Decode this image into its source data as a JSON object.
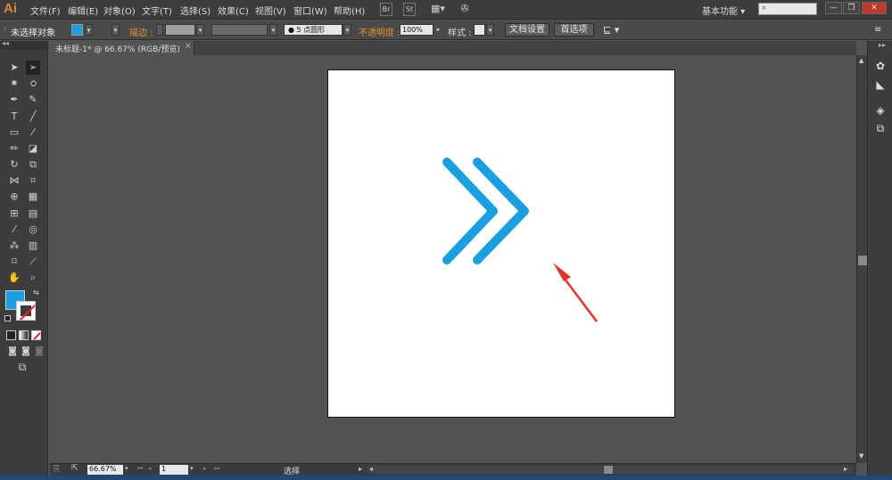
{
  "app": {
    "logo": "Ai",
    "menus": [
      "文件(F)",
      "编辑(E)",
      "对象(O)",
      "文字(T)",
      "选择(S)",
      "效果(C)",
      "视图(V)",
      "窗口(W)",
      "帮助(H)"
    ],
    "br_label": "Br",
    "st_label": "St",
    "workspace": "基本功能",
    "workspace_arrow": "▾",
    "search_placeholder": "",
    "minimize": "—",
    "restore": "❐",
    "close": "✕"
  },
  "control_bar": {
    "selection_label": "未选择对象",
    "stroke_label": "描边 :",
    "brush_value": "● 5 点圆形",
    "opacity_label": "不透明度 :",
    "opacity_value": "100%",
    "style_label": "样式 :",
    "doc_setup_label": "文档设置",
    "preferences_label": "首选项",
    "fill_color": "#1a9fe0"
  },
  "document": {
    "tab_title": "未标题-1* @ 66.67% (RGB/预览)",
    "tab_close": "×"
  },
  "status": {
    "zoom": "66.67%",
    "page": "1",
    "tool_status": "选择"
  },
  "artwork": {
    "chevron_color": "#1a9fe0",
    "arrow_color": "#e8302c"
  }
}
